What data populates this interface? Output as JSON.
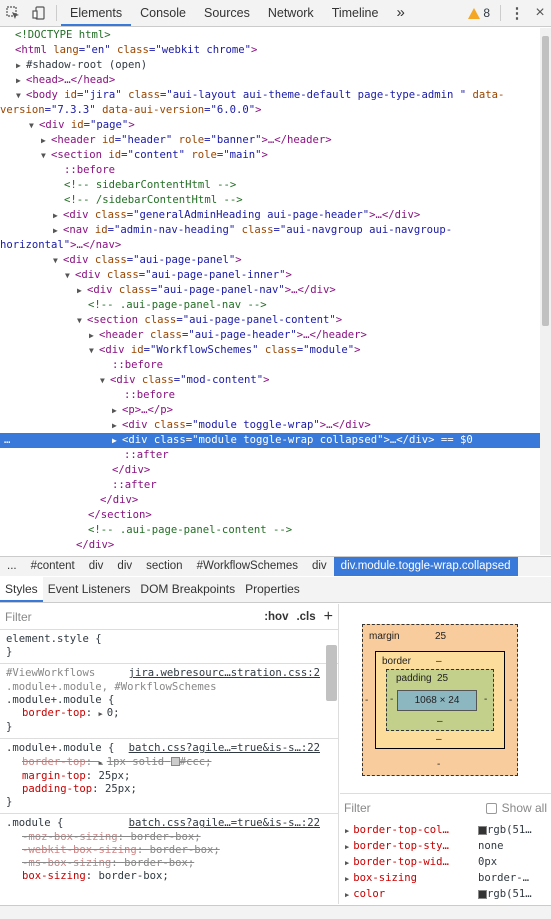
{
  "toolbar": {
    "tabs": [
      "Elements",
      "Console",
      "Sources",
      "Network",
      "Timeline"
    ],
    "more": "»",
    "warnings": "8"
  },
  "dom": [
    {
      "t": "<!DOCTYPE html>"
    },
    {
      "t": "html_open"
    },
    {
      "t": "#shadow-root (open)"
    },
    {
      "t": "head"
    },
    {
      "t": "body"
    },
    {
      "t": "div#page"
    },
    {
      "t": "header"
    },
    {
      "t": "section#content"
    }
  ],
  "dom_lines": {
    "l1": "<!DOCTYPE html>",
    "l2a": "<html",
    "l2b": " lang",
    "l2c": "=\"en\"",
    "l2d": " class",
    "l2e": "=\"webkit chrome\"",
    "l2f": ">",
    "l3": "#shadow-root (open)",
    "l4": "<head>…</head>",
    "l5a": "<body",
    "l5b": " id",
    "l5c": "=\"jira\"",
    "l5d": " class",
    "l5e": "=\"aui-layout aui-theme-default page-type-admin \"",
    "l5f": " data-",
    "l6a": "version",
    "l6b": "=\"7.3.3\"",
    "l6c": " data-aui-version",
    "l6d": "=\"6.0.0\"",
    "l6e": ">",
    "l7a": "<div",
    "l7b": " id",
    "l7c": "=\"page\"",
    "l7d": ">",
    "l8a": "<header",
    "l8b": " id",
    "l8c": "=\"header\"",
    "l8d": " role",
    "l8e": "=\"banner\"",
    "l8f": ">…</header>",
    "l9a": "<section",
    "l9b": " id",
    "l9c": "=\"content\"",
    "l9d": " role",
    "l9e": "=\"main\"",
    "l9f": ">",
    "l10": "::before",
    "l11": "<!-- sidebarContentHtml -->",
    "l12": "<!-- /sidebarContentHtml -->",
    "l13a": "<div",
    "l13b": " class",
    "l13c": "=\"generalAdminHeading aui-page-header\"",
    "l13d": ">…</div>",
    "l14a": "<nav",
    "l14b": " id",
    "l14c": "=\"admin-nav-heading\"",
    "l14d": " class",
    "l14e": "=\"aui-navgroup aui-navgroup-",
    "l15a": "horizontal\"",
    "l15b": ">…</nav>",
    "l16a": "<div",
    "l16b": " class",
    "l16c": "=\"aui-page-panel\"",
    "l16d": ">",
    "l17a": "<div",
    "l17b": " class",
    "l17c": "=\"aui-page-panel-inner\"",
    "l17d": ">",
    "l18a": "<div",
    "l18b": " class",
    "l18c": "=\"aui-page-panel-nav\"",
    "l18d": ">…</div>",
    "l19": "<!-- .aui-page-panel-nav -->",
    "l20a": "<section",
    "l20b": " class",
    "l20c": "=\"aui-page-panel-content\"",
    "l20d": ">",
    "l21a": "<header",
    "l21b": " class",
    "l21c": "=\"aui-page-header\"",
    "l21d": ">…</header>",
    "l22a": "<div",
    "l22b": " id",
    "l22c": "=\"WorkflowSchemes\"",
    "l22d": " class",
    "l22e": "=\"module\"",
    "l22f": ">",
    "l23": "::before",
    "l24a": "<div",
    "l24b": " class",
    "l24c": "=\"mod-content\"",
    "l24d": ">",
    "l25": "::before",
    "l26": "<p>…</p>",
    "l27a": "<div",
    "l27b": " class",
    "l27c": "=\"module toggle-wrap\"",
    "l27d": ">…</div>",
    "l28a": "<div",
    "l28b": " class",
    "l28c": "=\"module toggle-wrap collapsed\"",
    "l28d": ">…</div>",
    "l28e": " == $0",
    "l28dots": "…",
    "l29": "::after",
    "l30": "</div>",
    "l31": "::after",
    "l32": "</div>",
    "l33": "</section>",
    "l34": "<!-- .aui-page-panel-content -->",
    "l35": "</div>"
  },
  "breadcrumbs": [
    "...",
    "#content",
    "div",
    "div",
    "section",
    "#WorkflowSchemes",
    "div",
    "div.module.toggle-wrap.collapsed"
  ],
  "subtabs": [
    "Styles",
    "Event Listeners",
    "DOM Breakpoints",
    "Properties"
  ],
  "styles": {
    "filter_placeholder": "Filter",
    "hov": ":hov",
    "cls": ".cls",
    "plus": "+",
    "rule0_sel": "element.style {",
    "rule0_end": "}",
    "rule1_sel1": "#ViewWorkflows",
    "rule1_src": "jira.webresourc…stration.css:2",
    "rule1_sel2": ".module+.module, #WorkflowSchemes",
    "rule1_sel3": ".module+.module {",
    "rule1_p1n": "border-top",
    "rule1_p1v": "0;",
    "rule1_end": "}",
    "rule2_sel": ".module+.module {",
    "rule2_src": "batch.css?agile…=true&is-s…:22",
    "rule2_p1n": "border-top",
    "rule2_p1v": "1px solid",
    "rule2_p1c": "#ccc;",
    "rule2_p2n": "margin-top",
    "rule2_p2v": "25px;",
    "rule2_p3n": "padding-top",
    "rule2_p3v": "25px;",
    "rule2_end": "}",
    "rule3_sel": ".module {",
    "rule3_src": "batch.css?agile…=true&is-s…:22",
    "rule3_p1n": "-moz-box-sizing",
    "rule3_p1v": "border-box;",
    "rule3_p2n": "-webkit-box-sizing",
    "rule3_p2v": "border-box;",
    "rule3_p3n": "-ms-box-sizing",
    "rule3_p3v": "border-box;",
    "rule3_p4n": "box-sizing",
    "rule3_p4v": "border-box;"
  },
  "boxmodel": {
    "margin_label": "margin",
    "margin_top": "25",
    "margin_side": "-",
    "margin_bottom": "-",
    "border_label": "border",
    "border_val": "–",
    "padding_label": "padding",
    "padding_top": "25",
    "padding_side": "-",
    "padding_bottom": "–",
    "content": "1068 × 24"
  },
  "computed": {
    "filter_placeholder": "Filter",
    "show_all": "Show all",
    "rows": [
      {
        "name": "border-top-col…",
        "value": "rgb(51…",
        "swatch": "#333333"
      },
      {
        "name": "border-top-sty…",
        "value": "none"
      },
      {
        "name": "border-top-wid…",
        "value": "0px"
      },
      {
        "name": "box-sizing",
        "value": "border-…"
      },
      {
        "name": "color",
        "value": "rgb(51…",
        "swatch": "#333333"
      }
    ]
  },
  "colors": {
    "accent": "#3879d9",
    "tag": "#881280",
    "attr_name": "#994500",
    "attr_value": "#1a1aa6",
    "comment": "#236e25",
    "warning": "#f5a623"
  }
}
